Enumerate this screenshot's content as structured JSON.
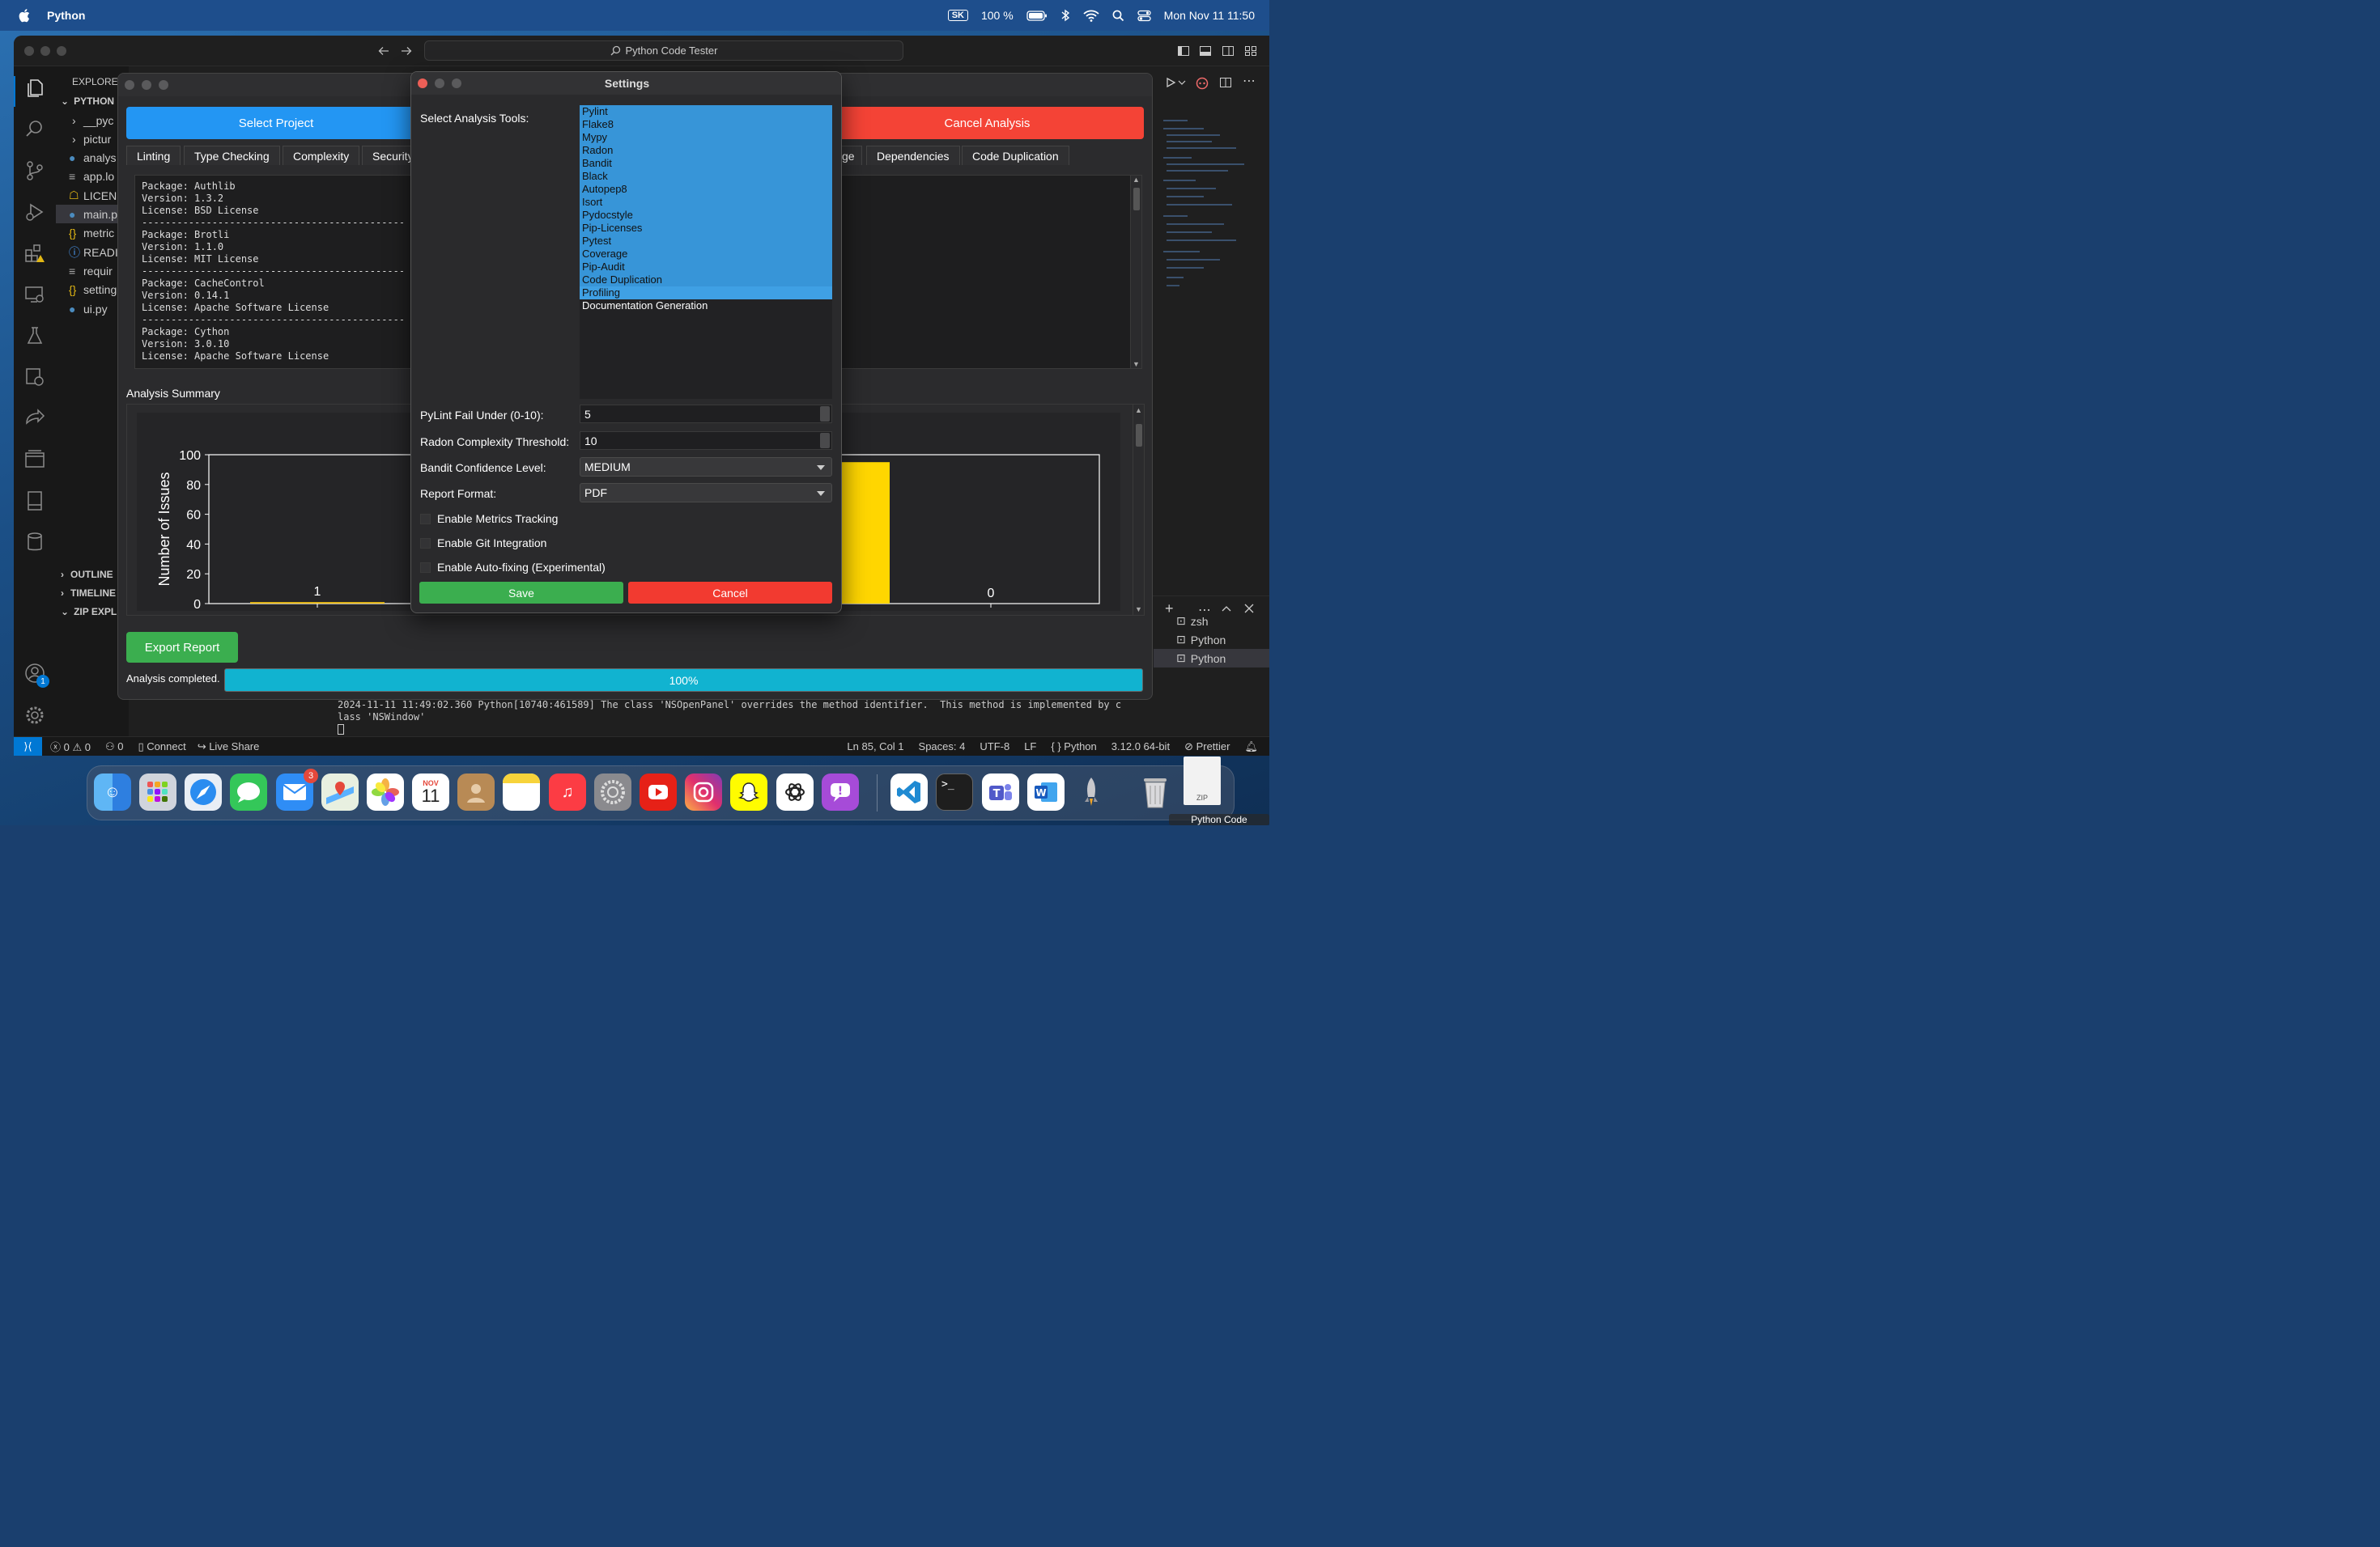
{
  "menubar": {
    "app": "Python",
    "input_source": "SK",
    "battery": "100 %",
    "datetime": "Mon Nov 11  11:50"
  },
  "vscode": {
    "command_center": "Python Code Tester",
    "explorer_header": "EXPLORE",
    "workspace": "PYTHON",
    "files": [
      "__pyc",
      "pictur",
      "analys",
      "app.lo",
      "LICEN",
      "main.p",
      "metric",
      "READI",
      "requir",
      "setting",
      "ui.py"
    ],
    "outline": "OUTLINE",
    "timeline": "TIMELINE",
    "zip_explorer": "ZIP EXPL",
    "terminal_lines": [
      "2024-11-11 11:49:02.360 Python[10740:461589] The class 'NSOpenPanel' overrides the method identifier.  This method is implemented by c",
      "lass 'NSWindow'"
    ],
    "terminals": [
      "zsh",
      "Python",
      "Python"
    ],
    "account_badge": "1",
    "status": {
      "errors": "0",
      "warnings": "0",
      "ports": "0",
      "connect": "Connect",
      "live_share": "Live Share",
      "position": "Ln 85, Col 1",
      "spaces": "Spaces: 4",
      "encoding": "UTF-8",
      "eol": "LF",
      "language": "Python",
      "version": "3.12.0 64-bit",
      "prettier": "Prettier"
    }
  },
  "app": {
    "select_project": "Select Project",
    "cancel_analysis": "Cancel Analysis",
    "tabs_left": [
      "Linting",
      "Type Checking",
      "Complexity",
      "Security"
    ],
    "tabs_right": [
      "ge",
      "Dependencies",
      "Code Duplication"
    ],
    "packages": "Package: Authlib\nVersion: 1.3.2\nLicense: BSD License\n---------------------------------------------\nPackage: Brotli\nVersion: 1.1.0\nLicense: MIT License\n---------------------------------------------\nPackage: CacheControl\nVersion: 0.14.1\nLicense: Apache Software License\n---------------------------------------------\nPackage: Cython\nVersion: 3.0.10\nLicense: Apache Software License",
    "summary_label": "Analysis Summary",
    "export_report": "Export Report",
    "status": "Analysis completed.",
    "progress": "100%",
    "progress_value": 100
  },
  "chart_data": {
    "type": "bar",
    "ylabel": "Number of Issues",
    "ylim": [
      0,
      100
    ],
    "yticks": [
      "0",
      "20",
      "40",
      "60",
      "80",
      "100"
    ],
    "visible_labels": [
      "1",
      "0"
    ],
    "bars": [
      {
        "value": 1,
        "label": "1",
        "color": "#f5c518"
      },
      {
        "value": 95,
        "label": "",
        "color": "#ffd600"
      },
      {
        "value": 0,
        "label": "0",
        "color": "#ffd600"
      }
    ]
  },
  "settings": {
    "title": "Settings",
    "tools_label": "Select Analysis Tools:",
    "tools": [
      "Pylint",
      "Flake8",
      "Mypy",
      "Radon",
      "Bandit",
      "Black",
      "Autopep8",
      "Isort",
      "Pydocstyle",
      "Pip-Licenses",
      "Pytest",
      "Coverage",
      "Pip-Audit",
      "Code Duplication",
      "Profiling",
      "Documentation Generation"
    ],
    "selected_count": 15,
    "pylint_label": "PyLint Fail Under (0-10):",
    "pylint_value": "5",
    "radon_label": "Radon Complexity Threshold:",
    "radon_value": "10",
    "bandit_label": "Bandit Confidence Level:",
    "bandit_value": "MEDIUM",
    "report_label": "Report Format:",
    "report_value": "PDF",
    "check_metrics": "Enable Metrics Tracking",
    "check_git": "Enable Git Integration",
    "check_autofix": "Enable Auto-fixing (Experimental)",
    "save": "Save",
    "cancel": "Cancel"
  },
  "dock": {
    "mail_badge": "3",
    "calendar_month": "NOV",
    "calendar_day": "11",
    "zip_label": "Python Code",
    "zip_icon_text": "ZIP"
  }
}
